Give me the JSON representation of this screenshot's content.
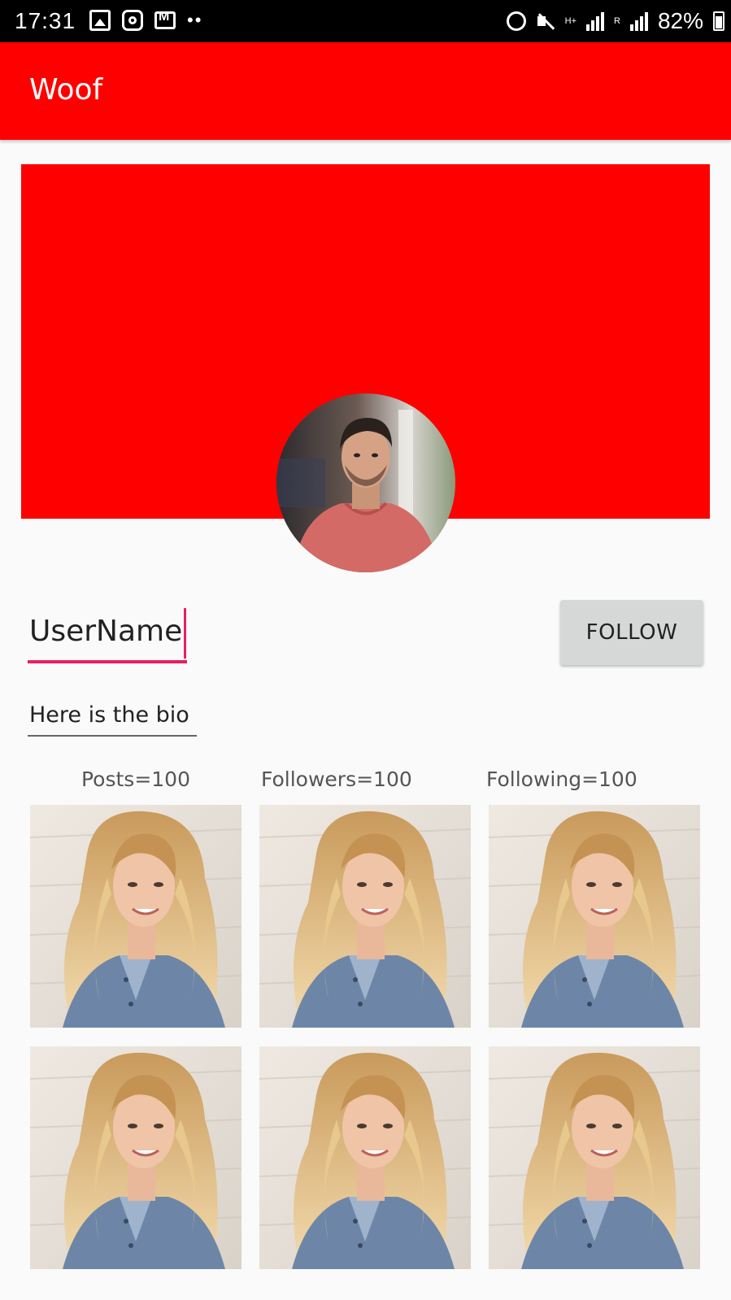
{
  "status_bar": {
    "time": "17:31",
    "network": "H+",
    "roaming": "R",
    "battery": "82%",
    "left_icons": [
      "gallery-icon",
      "instagram-icon",
      "mail-icon"
    ],
    "right_icons": [
      "alarm-icon",
      "mute-icon",
      "signal-icon",
      "battery-icon"
    ]
  },
  "app_bar": {
    "title": "Woof",
    "color": "#ff0000"
  },
  "profile": {
    "cover_color": "#ff0000",
    "username": "UserName",
    "follow_label": "FOLLOW",
    "bio": "Here is the bio",
    "accent_color": "#e91e63"
  },
  "stats": {
    "posts": "Posts=100",
    "followers": "Followers=100",
    "following": "Following=100"
  }
}
